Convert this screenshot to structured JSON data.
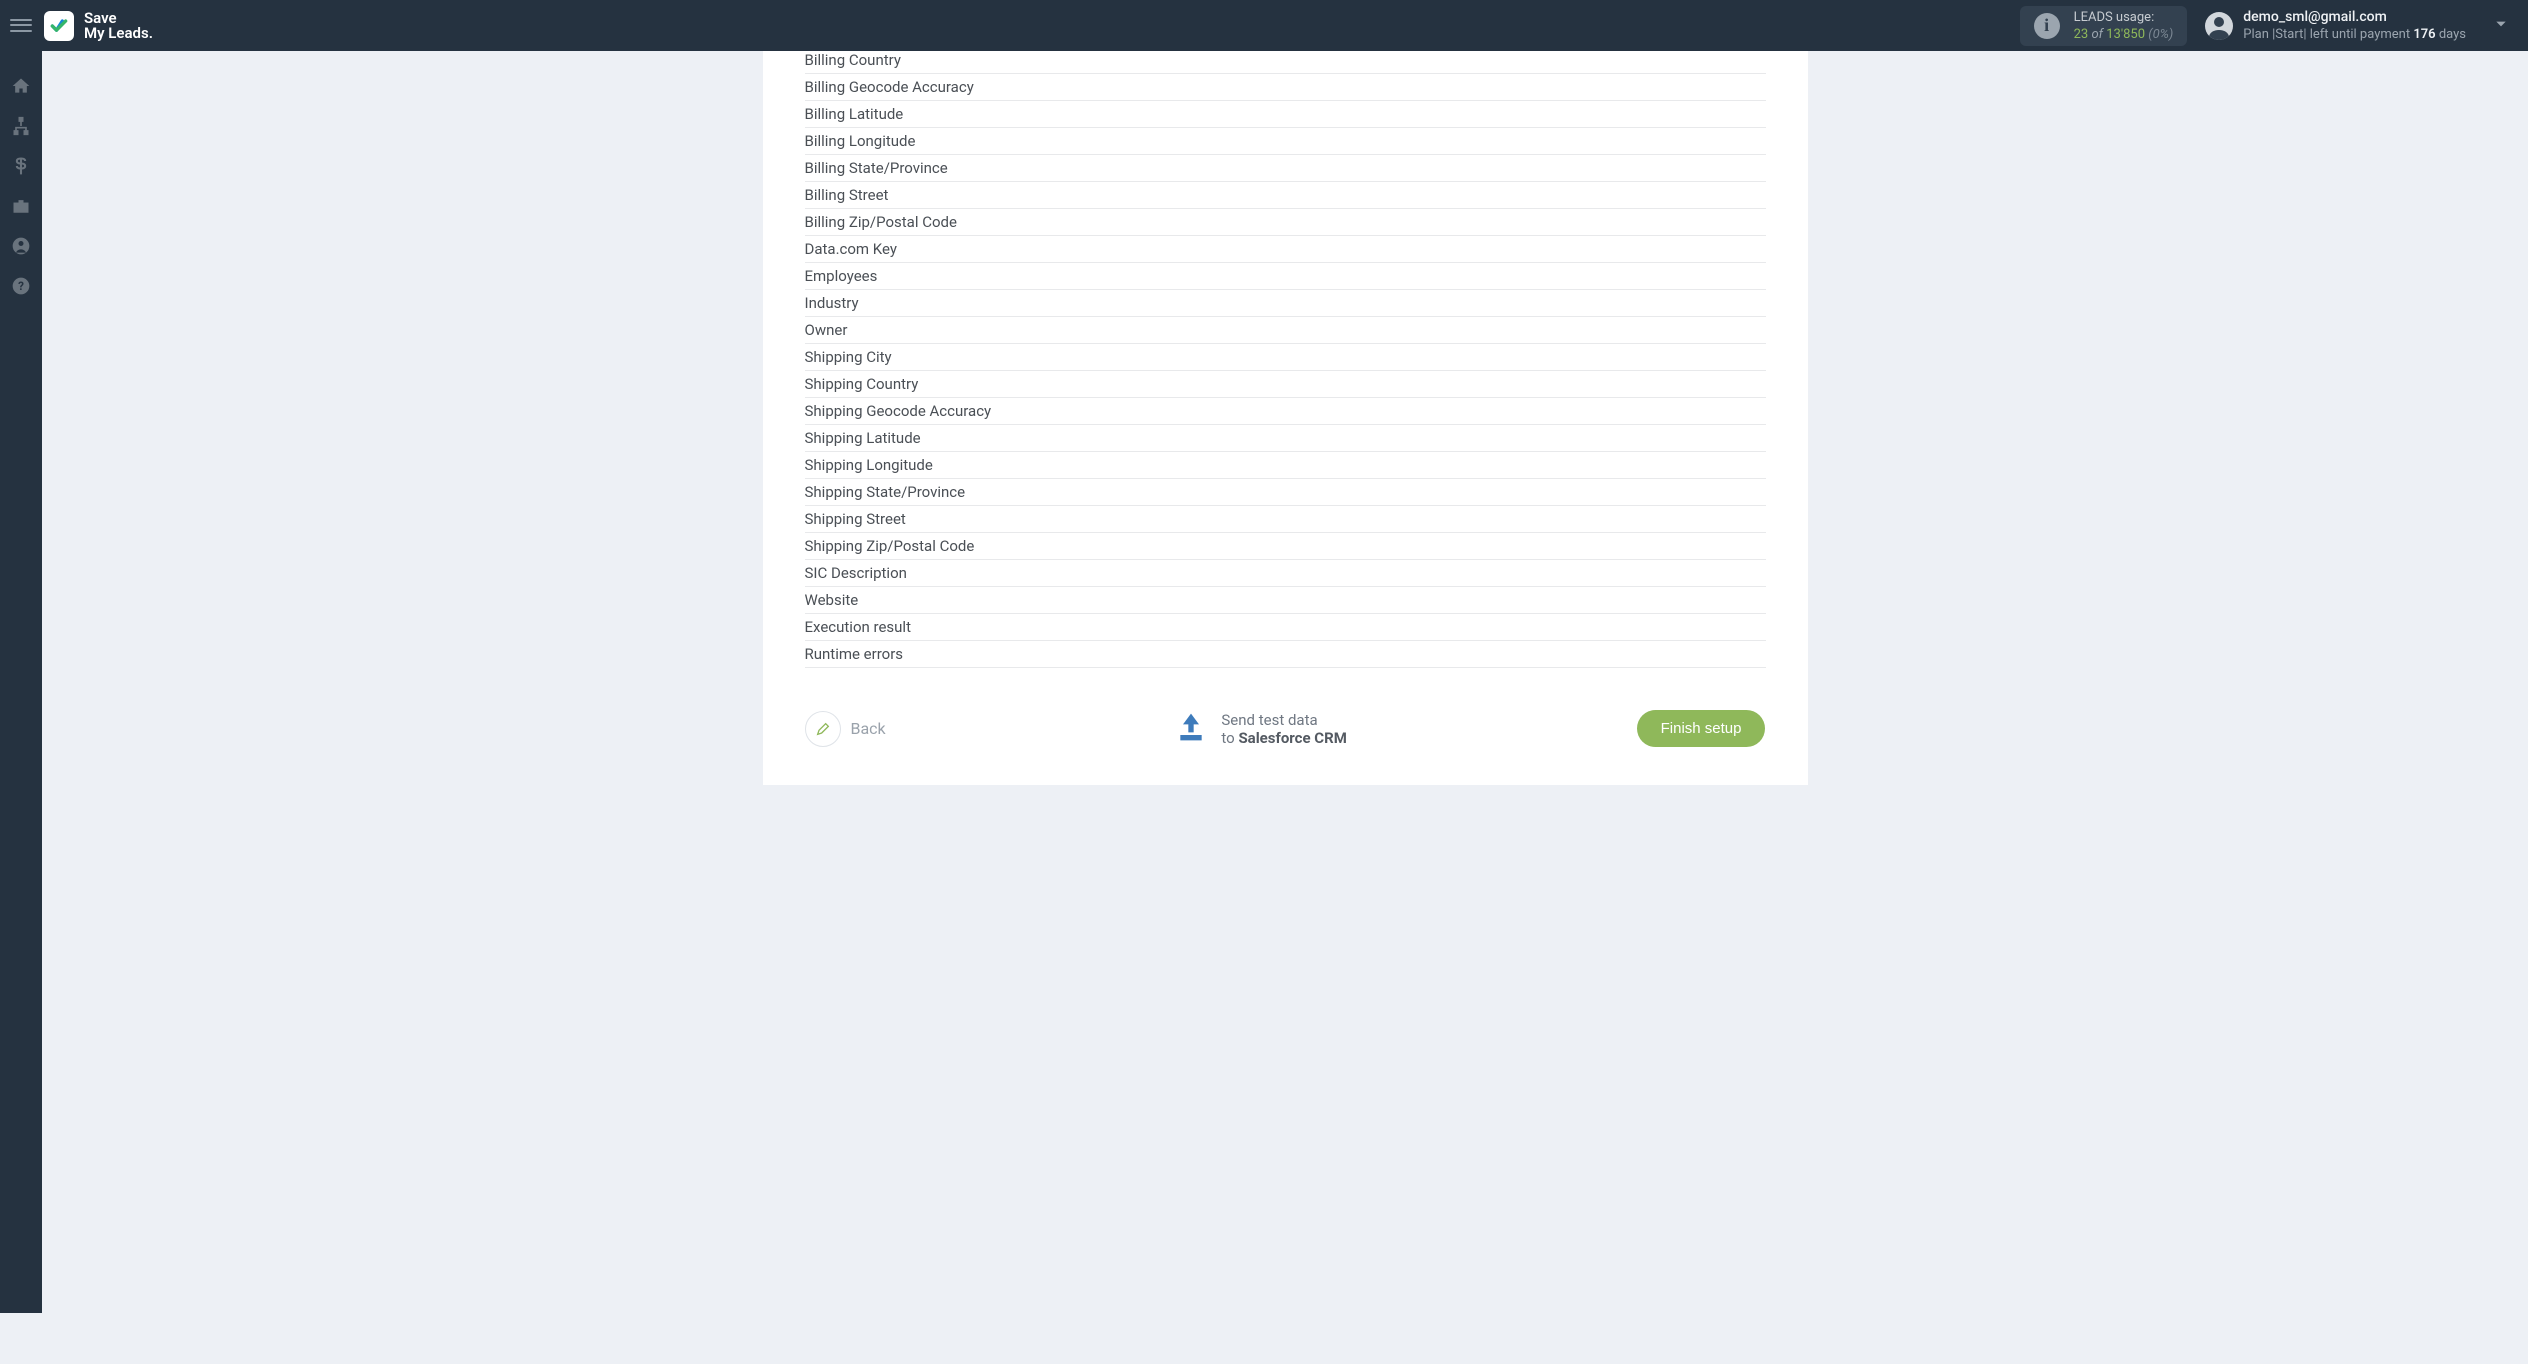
{
  "brand": {
    "line1": "Save",
    "line2": "My Leads"
  },
  "leads": {
    "title": "LEADS usage:",
    "used": "23",
    "of_word": "of",
    "total": "13'850",
    "percent": "(0%)"
  },
  "user": {
    "email": "demo_sml@gmail.com",
    "plan_prefix": "Plan |Start| left until payment ",
    "days_num": "176",
    "days_suffix": " days"
  },
  "fields": [
    "Billing Country",
    "Billing Geocode Accuracy",
    "Billing Latitude",
    "Billing Longitude",
    "Billing State/Province",
    "Billing Street",
    "Billing Zip/Postal Code",
    "Data.com Key",
    "Employees",
    "Industry",
    "Owner",
    "Shipping City",
    "Shipping Country",
    "Shipping Geocode Accuracy",
    "Shipping Latitude",
    "Shipping Longitude",
    "Shipping State/Province",
    "Shipping Street",
    "Shipping Zip/Postal Code",
    "SIC Description",
    "Website",
    "Execution result",
    "Runtime errors"
  ],
  "footer": {
    "back": "Back",
    "send_line1": "Send test data",
    "send_line2_prefix": "to ",
    "send_line2_bold": "Salesforce CRM",
    "finish": "Finish setup"
  }
}
